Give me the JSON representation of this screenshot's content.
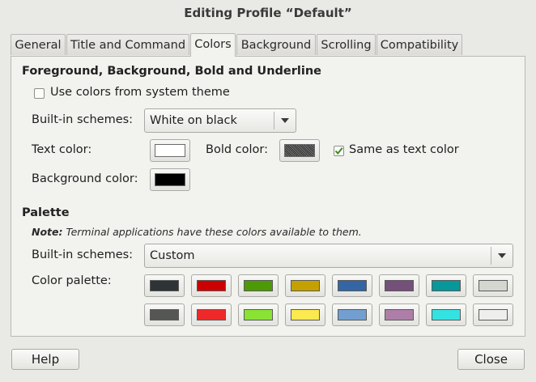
{
  "window": {
    "title": "Editing Profile “Default”"
  },
  "tabs": [
    {
      "label": "General"
    },
    {
      "label": "Title and Command"
    },
    {
      "label": "Colors"
    },
    {
      "label": "Background"
    },
    {
      "label": "Scrolling"
    },
    {
      "label": "Compatibility"
    }
  ],
  "active_tab": "Colors",
  "fg_section": {
    "heading": "Foreground, Background, Bold and Underline",
    "use_system_colors": {
      "label": "Use colors from system theme",
      "checked": false
    },
    "scheme_label": "Built-in schemes:",
    "scheme_value": "White on black",
    "text_color_label": "Text color:",
    "text_color": "#ffffff",
    "bold_color_label": "Bold color:",
    "bold_color": "#3a3a3a",
    "same_as_text": {
      "label": "Same as text color",
      "checked": true
    },
    "background_color_label": "Background color:",
    "background_color": "#000000"
  },
  "palette_section": {
    "heading": "Palette",
    "note_bold": "Note:",
    "note_text": "Terminal applications have these colors available to them.",
    "scheme_label": "Built-in schemes:",
    "scheme_value": "Custom",
    "palette_label": "Color palette:",
    "colors": [
      "#2e3436",
      "#cc0000",
      "#4e9a06",
      "#c4a000",
      "#3465a4",
      "#75507b",
      "#06989a",
      "#d3d7cf",
      "#555753",
      "#ef2929",
      "#8ae234",
      "#fce94f",
      "#729fcf",
      "#ad7fa8",
      "#34e2e2",
      "#eeeeec"
    ]
  },
  "buttons": {
    "help": "Help",
    "close": "Close"
  }
}
